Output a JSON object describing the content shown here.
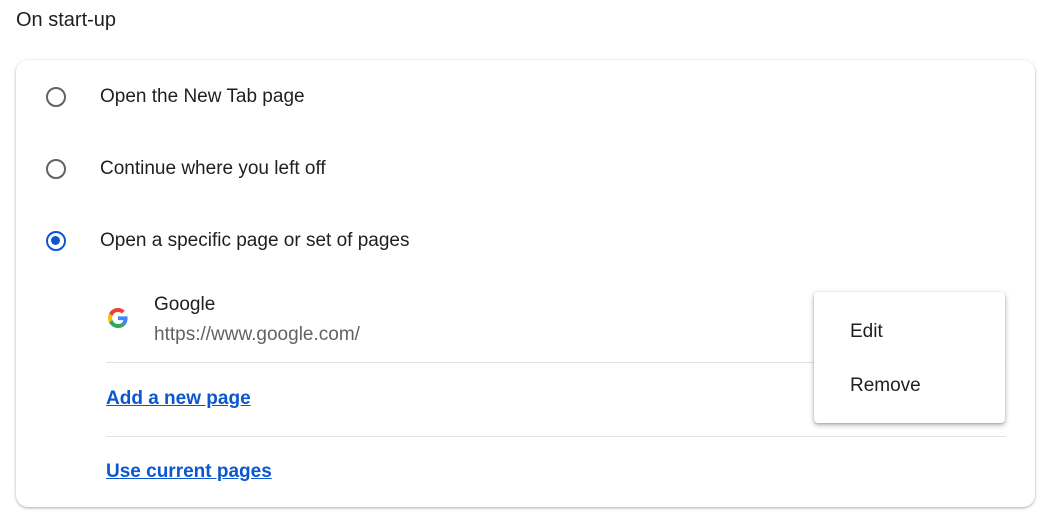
{
  "section": {
    "title": "On start-up"
  },
  "startup_options": [
    {
      "label": "Open the New Tab page",
      "selected": false
    },
    {
      "label": "Continue where you left off",
      "selected": false
    },
    {
      "label": "Open a specific page or set of pages",
      "selected": true
    }
  ],
  "pages": [
    {
      "name": "Google",
      "url": "https://www.google.com/",
      "icon": "google-g-icon"
    }
  ],
  "actions": {
    "add_new_page": "Add a new page",
    "use_current_pages": "Use current pages"
  },
  "context_menu": {
    "items": [
      "Edit",
      "Remove"
    ]
  },
  "colors": {
    "accent": "#0b57d0",
    "text": "#1f1f1f",
    "secondary_text": "#5f6368",
    "divider": "#e3e3e3"
  }
}
